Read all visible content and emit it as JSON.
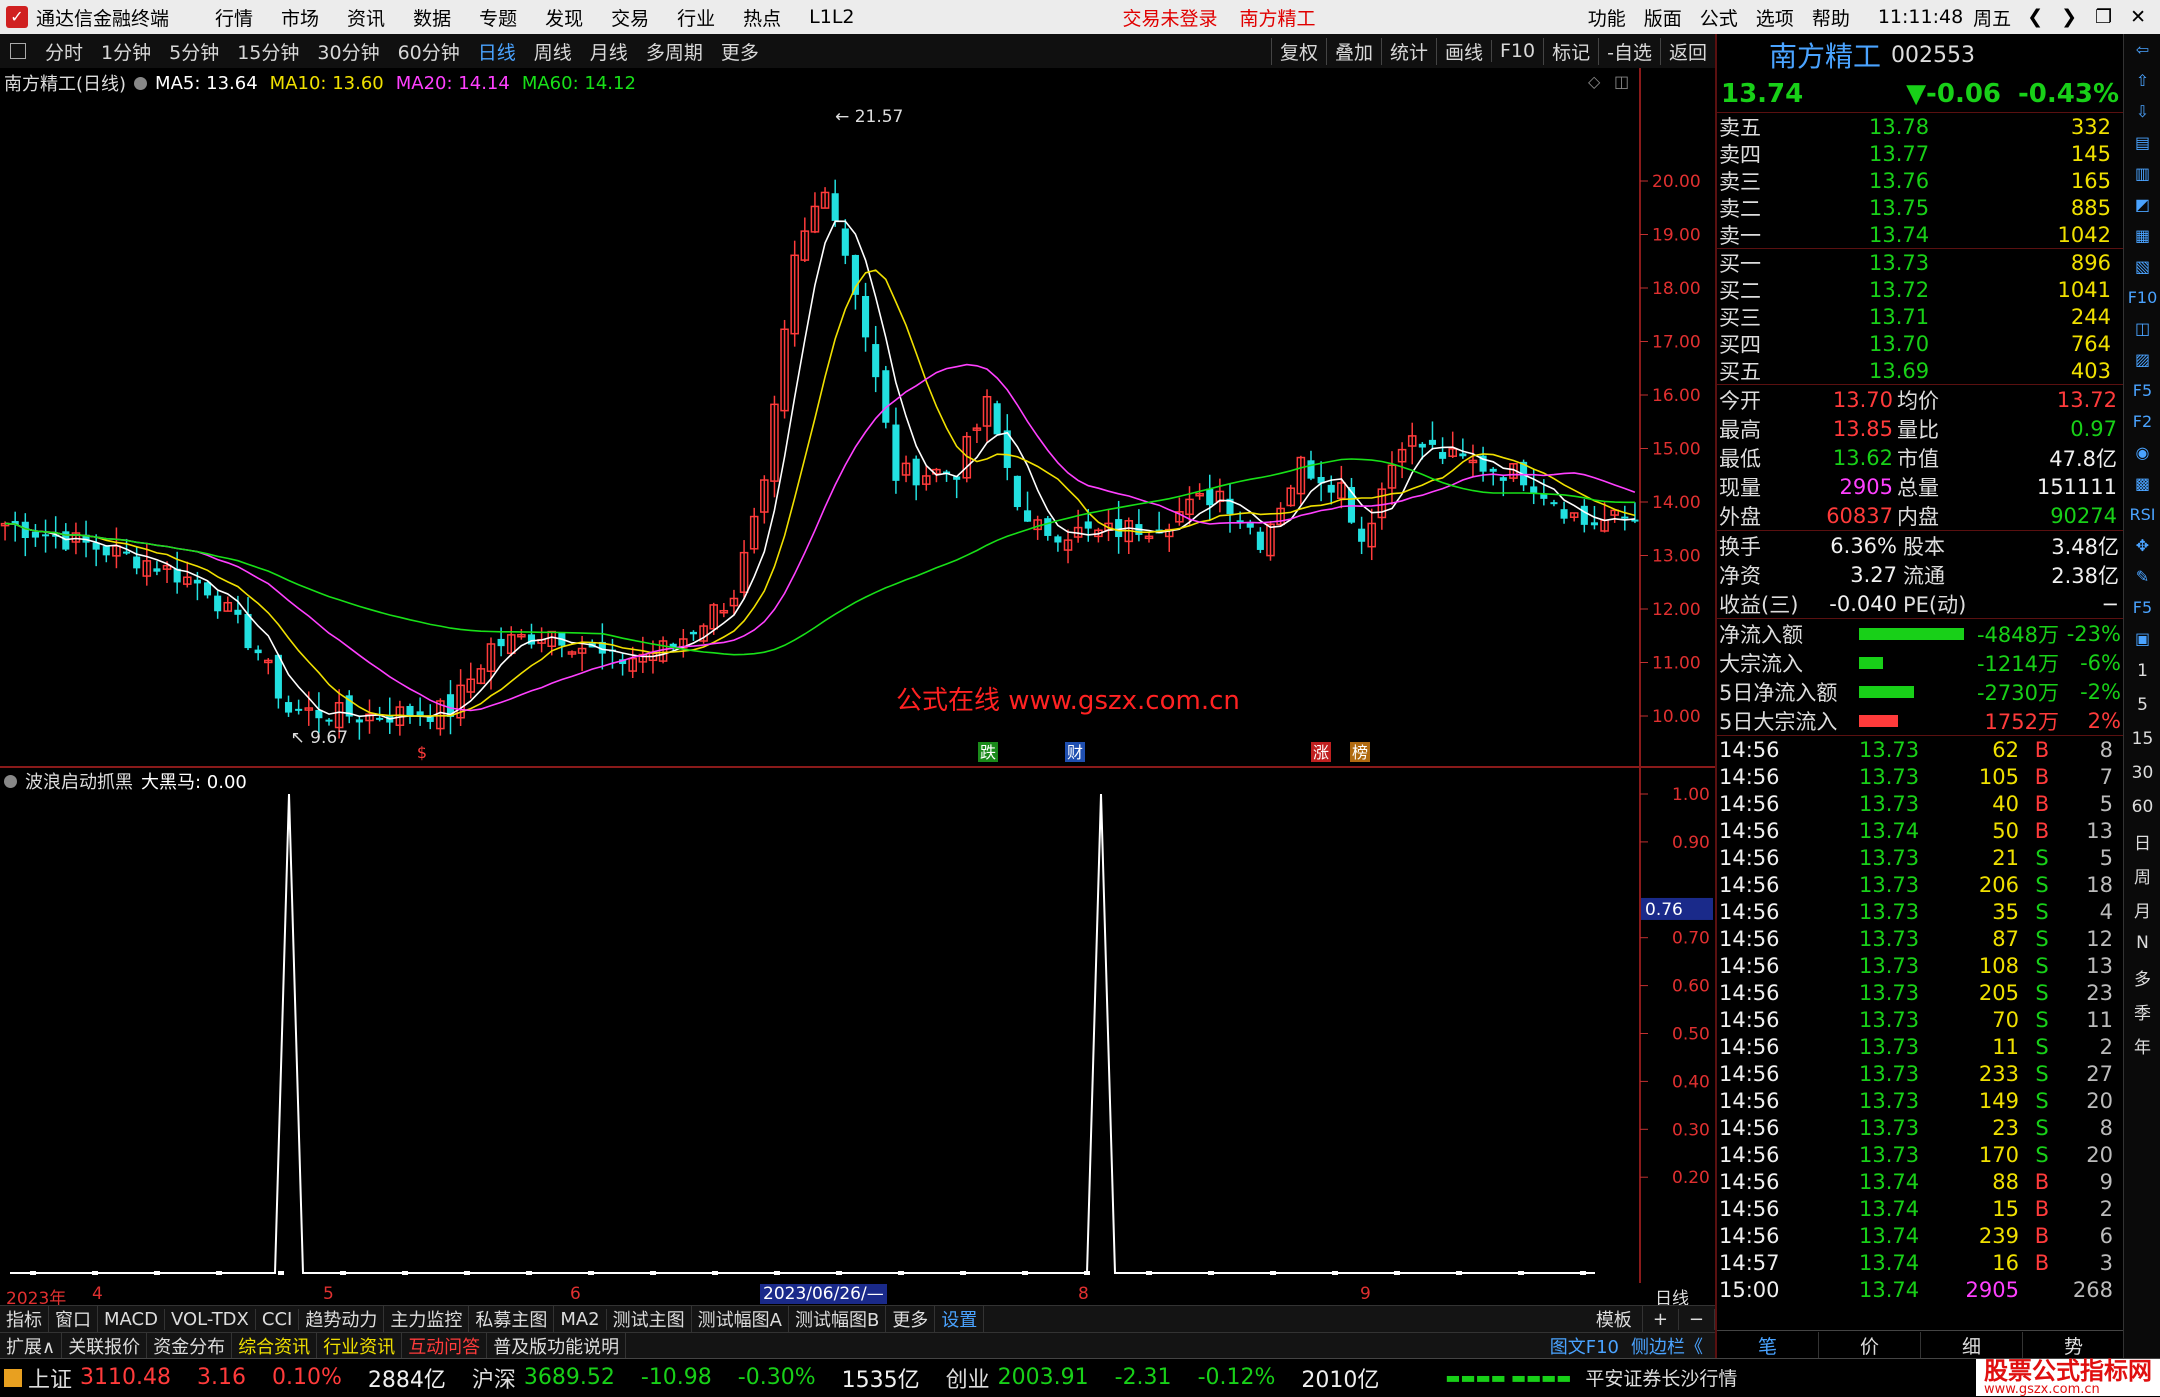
{
  "menubar": {
    "app_title": "通达信金融终端",
    "menus": [
      "行情",
      "市场",
      "资讯",
      "数据",
      "专题",
      "发现",
      "交易",
      "行业",
      "热点",
      "L1L2"
    ],
    "login_status": "交易未登录",
    "stock_name": "南方精工",
    "right_menus": [
      "功能",
      "版面",
      "公式",
      "选项",
      "帮助"
    ],
    "time": "11:11:48",
    "weekday": "周五"
  },
  "toolbar": {
    "periods": [
      "分时",
      "1分钟",
      "5分钟",
      "15分钟",
      "30分钟",
      "60分钟",
      "日线",
      "周线",
      "月线",
      "多周期",
      "更多"
    ],
    "active_period": "日线",
    "tools": [
      "复权",
      "叠加",
      "统计",
      "画线",
      "F10",
      "标记",
      "-自选",
      "返回"
    ]
  },
  "main_chart": {
    "title": "南方精工(日线)",
    "ma": [
      {
        "label": "MA5: 13.64",
        "color": "#ffffff"
      },
      {
        "label": "MA10: 13.60",
        "color": "#f0e000"
      },
      {
        "label": "MA20: 14.14",
        "color": "#ff40ff"
      },
      {
        "label": "MA60: 14.12",
        "color": "#18e018"
      }
    ],
    "price_ticks": [
      "20.00",
      "19.00",
      "18.00",
      "17.00",
      "16.00",
      "15.00",
      "14.00",
      "13.00",
      "12.00",
      "11.00",
      "10.00"
    ],
    "high_label": "21.57",
    "low_label": "9.67",
    "watermark": "公式在线  www.gszx.com.cn",
    "event_marks": [
      {
        "text": "$",
        "color": "#ff3b3b",
        "bg": "none"
      },
      {
        "text": "跌",
        "color": "#ffffff",
        "bg": "#1a8a1a"
      },
      {
        "text": "财",
        "color": "#ffffff",
        "bg": "#1f4fb0"
      },
      {
        "text": "涨",
        "color": "#ffffff",
        "bg": "#c02020"
      },
      {
        "text": "榜",
        "color": "#ffffff",
        "bg": "#b06a10"
      }
    ]
  },
  "sub_chart": {
    "title": "波浪启动抓黑",
    "value_label": "大黑马: 0.00",
    "ticks": [
      "1.00",
      "0.90",
      "0.70",
      "0.60",
      "0.50",
      "0.40",
      "0.30",
      "0.20"
    ],
    "current": "0.76"
  },
  "date_axis": {
    "labels": [
      "2023年",
      "4",
      "5",
      "6",
      "2023/06/26/—",
      "8",
      "9"
    ],
    "period": "日线"
  },
  "tabs1": [
    "指标",
    "窗口",
    "MACD",
    "VOL-TDX",
    "CCI",
    "趋势动力",
    "主力监控",
    "私募主图",
    "MA2",
    "测试主图",
    "测试幅图A",
    "测试幅图B",
    "更多",
    "设置"
  ],
  "tabs1_right": [
    "模板",
    "+",
    "−"
  ],
  "tabs2": [
    "扩展∧",
    "关联报价",
    "资金分布",
    "综合资讯",
    "行业资讯",
    "互动问答",
    "普及版功能说明"
  ],
  "tabs2_right": [
    "图文F10",
    "侧边栏《"
  ],
  "quote": {
    "name": "南方精工",
    "code": "002553",
    "price": "13.74",
    "change": "▼-0.06",
    "pct": "-0.43%",
    "asks": [
      {
        "label": "卖五",
        "price": "13.78",
        "vol": "332"
      },
      {
        "label": "卖四",
        "price": "13.77",
        "vol": "145"
      },
      {
        "label": "卖三",
        "price": "13.76",
        "vol": "165"
      },
      {
        "label": "卖二",
        "price": "13.75",
        "vol": "885"
      },
      {
        "label": "卖一",
        "price": "13.74",
        "vol": "1042"
      }
    ],
    "bids": [
      {
        "label": "买一",
        "price": "13.73",
        "vol": "896"
      },
      {
        "label": "买二",
        "price": "13.72",
        "vol": "1041"
      },
      {
        "label": "买三",
        "price": "13.71",
        "vol": "244"
      },
      {
        "label": "买四",
        "price": "13.70",
        "vol": "764"
      },
      {
        "label": "买五",
        "price": "13.69",
        "vol": "403"
      }
    ],
    "stats": [
      {
        "l1": "今开",
        "v1": "13.70",
        "c1": "up",
        "l2": "均价",
        "v2": "13.72",
        "c2": "up"
      },
      {
        "l1": "最高",
        "v1": "13.85",
        "c1": "up",
        "l2": "量比",
        "v2": "0.97",
        "c2": "dn"
      },
      {
        "l1": "最低",
        "v1": "13.62",
        "c1": "dn",
        "l2": "市值",
        "v2": "47.8亿",
        "c2": "wh"
      },
      {
        "l1": "现量",
        "v1": "2905",
        "c1": "mg",
        "l2": "总量",
        "v2": "151111",
        "c2": "wh"
      },
      {
        "l1": "外盘",
        "v1": "60837",
        "c1": "up",
        "l2": "内盘",
        "v2": "90274",
        "c2": "dn"
      }
    ],
    "stats2": [
      {
        "l1": "换手",
        "v1": "6.36%",
        "l2": "股本",
        "v2": "3.48亿"
      },
      {
        "l1": "净资",
        "v1": "3.27",
        "l2": "流通",
        "v2": "2.38亿"
      },
      {
        "l1": "收益(三)",
        "v1": "-0.040",
        "l2": "PE(动)",
        "v2": "−"
      }
    ],
    "flows": [
      {
        "label": "净流入额",
        "bar": 0.95,
        "color": "#18d018",
        "value": "-4848万",
        "pct": "-23%",
        "vc": "dn"
      },
      {
        "label": "大宗流入",
        "bar": 0.22,
        "color": "#18d018",
        "value": "-1214万",
        "pct": "-6%",
        "vc": "dn"
      },
      {
        "label": "5日净流入额",
        "bar": 0.5,
        "color": "#18d018",
        "value": "-2730万",
        "pct": "-2%",
        "vc": "dn"
      },
      {
        "label": "5日大宗流入",
        "bar": 0.35,
        "color": "#ff3b3b",
        "value": "1752万",
        "pct": "2%",
        "vc": "up"
      }
    ],
    "ticks": [
      {
        "t": "14:56",
        "p": "13.73",
        "v": "62",
        "s": "B",
        "n": "8"
      },
      {
        "t": "14:56",
        "p": "13.73",
        "v": "105",
        "s": "B",
        "n": "7"
      },
      {
        "t": "14:56",
        "p": "13.73",
        "v": "40",
        "s": "B",
        "n": "5"
      },
      {
        "t": "14:56",
        "p": "13.74",
        "v": "50",
        "s": "B",
        "n": "13"
      },
      {
        "t": "14:56",
        "p": "13.73",
        "v": "21",
        "s": "S",
        "n": "5"
      },
      {
        "t": "14:56",
        "p": "13.73",
        "v": "206",
        "s": "S",
        "n": "18"
      },
      {
        "t": "14:56",
        "p": "13.73",
        "v": "35",
        "s": "S",
        "n": "4"
      },
      {
        "t": "14:56",
        "p": "13.73",
        "v": "87",
        "s": "S",
        "n": "12"
      },
      {
        "t": "14:56",
        "p": "13.73",
        "v": "108",
        "s": "S",
        "n": "13"
      },
      {
        "t": "14:56",
        "p": "13.73",
        "v": "205",
        "s": "S",
        "n": "23"
      },
      {
        "t": "14:56",
        "p": "13.73",
        "v": "70",
        "s": "S",
        "n": "11"
      },
      {
        "t": "14:56",
        "p": "13.73",
        "v": "11",
        "s": "S",
        "n": "2"
      },
      {
        "t": "14:56",
        "p": "13.73",
        "v": "233",
        "s": "S",
        "n": "27"
      },
      {
        "t": "14:56",
        "p": "13.73",
        "v": "149",
        "s": "S",
        "n": "20"
      },
      {
        "t": "14:56",
        "p": "13.73",
        "v": "23",
        "s": "S",
        "n": "8"
      },
      {
        "t": "14:56",
        "p": "13.73",
        "v": "170",
        "s": "S",
        "n": "20"
      },
      {
        "t": "14:56",
        "p": "13.74",
        "v": "88",
        "s": "B",
        "n": "9"
      },
      {
        "t": "14:56",
        "p": "13.74",
        "v": "15",
        "s": "B",
        "n": "2"
      },
      {
        "t": "14:56",
        "p": "13.74",
        "v": "239",
        "s": "B",
        "n": "6"
      },
      {
        "t": "14:57",
        "p": "13.74",
        "v": "16",
        "s": "B",
        "n": "3"
      },
      {
        "t": "15:00",
        "p": "13.74",
        "v": "2905",
        "s": "",
        "n": "268"
      }
    ],
    "bottom_tabs": [
      "笔",
      "价",
      "细",
      "势"
    ]
  },
  "status": {
    "indices": [
      {
        "name": "上证",
        "value": "3110.48",
        "chg": "3.16",
        "pct": "0.10%",
        "amt": "2884亿",
        "dir": "up"
      },
      {
        "name": "沪深",
        "value": "3689.52",
        "chg": "-10.98",
        "pct": "-0.30%",
        "amt": "1535亿",
        "dir": "dn"
      },
      {
        "name": "创业",
        "value": "2003.91",
        "chg": "-2.31",
        "pct": "-0.12%",
        "amt": "2010亿",
        "dir": "dn"
      }
    ],
    "broker": "平安证券长沙行情",
    "logo": "股票公式指标网",
    "logo_url": "www.gszx.com.cn"
  },
  "sidebar_items": [
    "⇦",
    "⇧",
    "⇩",
    "▤",
    "▥",
    "◩",
    "▦",
    "▧",
    "F10",
    "◫",
    "▨",
    "F5",
    "F2",
    "◉",
    "▩",
    "RSI",
    "✥",
    "✎",
    "F5",
    "▣",
    "1",
    "5",
    "15",
    "30",
    "60",
    "日",
    "周",
    "月",
    "N",
    "多",
    "季",
    "年"
  ]
}
